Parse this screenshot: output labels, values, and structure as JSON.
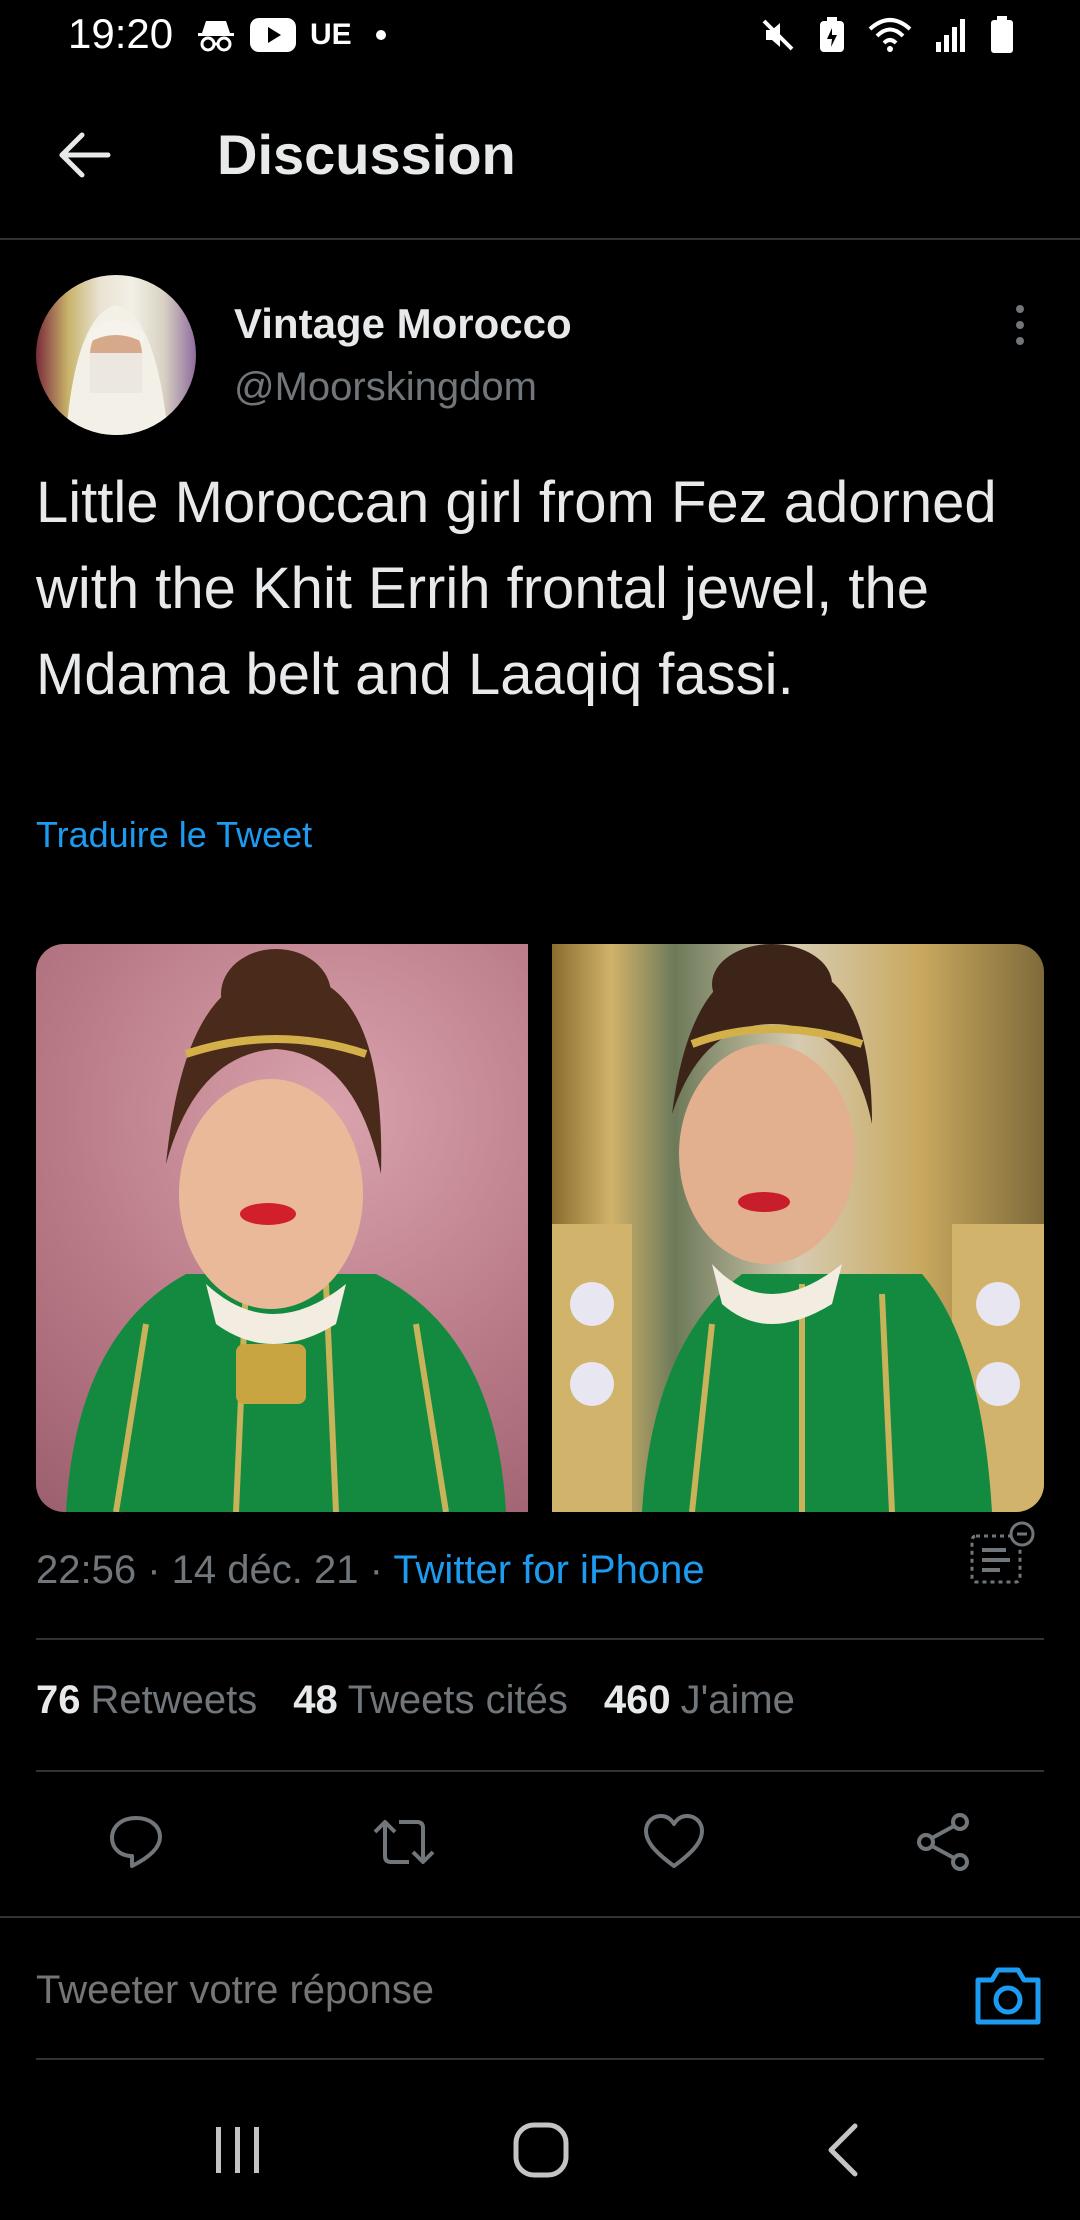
{
  "status_bar": {
    "time": "19:20",
    "carrier_text": "UE",
    "icons_left": [
      "incognito-icon",
      "youtube-icon"
    ],
    "icons_right": [
      "mute-icon",
      "battery-saver-icon",
      "wifi-icon",
      "signal-icon",
      "battery-icon"
    ]
  },
  "header": {
    "title": "Discussion"
  },
  "tweet": {
    "author_name": "Vintage Morocco",
    "author_handle": "@Moorskingdom",
    "text": "Little Moroccan girl from Fez adorned with the Khit Errih frontal jewel, the Mdama belt and Laaqiq fassi.",
    "translate_label": "Traduire le Tweet",
    "time": "22:56",
    "date": "14 déc. 21",
    "source": "Twitter for iPhone",
    "separator": " · "
  },
  "stats": [
    {
      "count": "76",
      "label": "Retweets"
    },
    {
      "count": "48",
      "label": "Tweets cités"
    },
    {
      "count": "460",
      "label": "J'aime"
    }
  ],
  "reply": {
    "placeholder": "Tweeter votre réponse"
  },
  "colors": {
    "background": "#000000",
    "text_primary": "#e7e9ea",
    "text_secondary": "#71767b",
    "accent": "#1d9bf0",
    "divider": "#2f3336"
  }
}
